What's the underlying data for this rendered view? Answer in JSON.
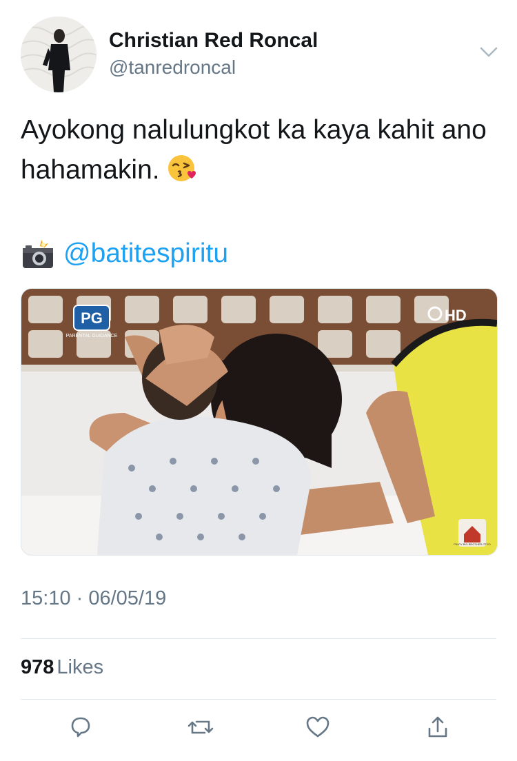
{
  "tweet": {
    "author": {
      "display_name": "Christian Red Roncal",
      "handle": "@tanredroncal"
    },
    "text": "Ayokong nalulungkot ka kaya kahit ano hahamakin.",
    "emoji_icon": "face-throwing-kiss-icon",
    "photo_credit_icon": "camera-with-flash-icon",
    "mention": "@batitespiritu",
    "media": {
      "rating_badge": "PG",
      "rating_subtext": "PARENTAL GUIDANCE",
      "broadcaster_badge": "HD",
      "show_badge": "PINOY BIG BROTHER OTSO"
    },
    "timestamp": "15:10 · 06/05/19",
    "likes_count": "978",
    "likes_label": "Likes"
  },
  "actions": [
    "reply-icon",
    "retweet-icon",
    "like-icon",
    "share-icon"
  ],
  "colors": {
    "text": "#14171a",
    "secondary": "#657786",
    "link": "#1da1f2",
    "divider": "#e1e8ed"
  }
}
